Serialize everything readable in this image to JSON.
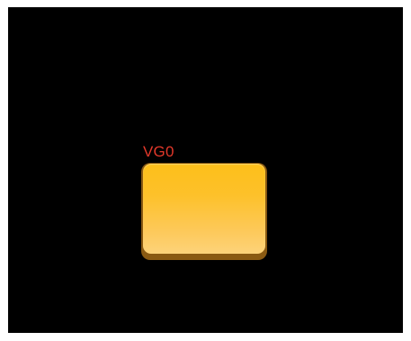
{
  "canvas": {
    "background_color": "#000000"
  },
  "volume_group": {
    "label": "VG0",
    "label_color": "#e2382a",
    "block_color": "#fdc12a",
    "block_shadow_color": "#8a5a12"
  }
}
